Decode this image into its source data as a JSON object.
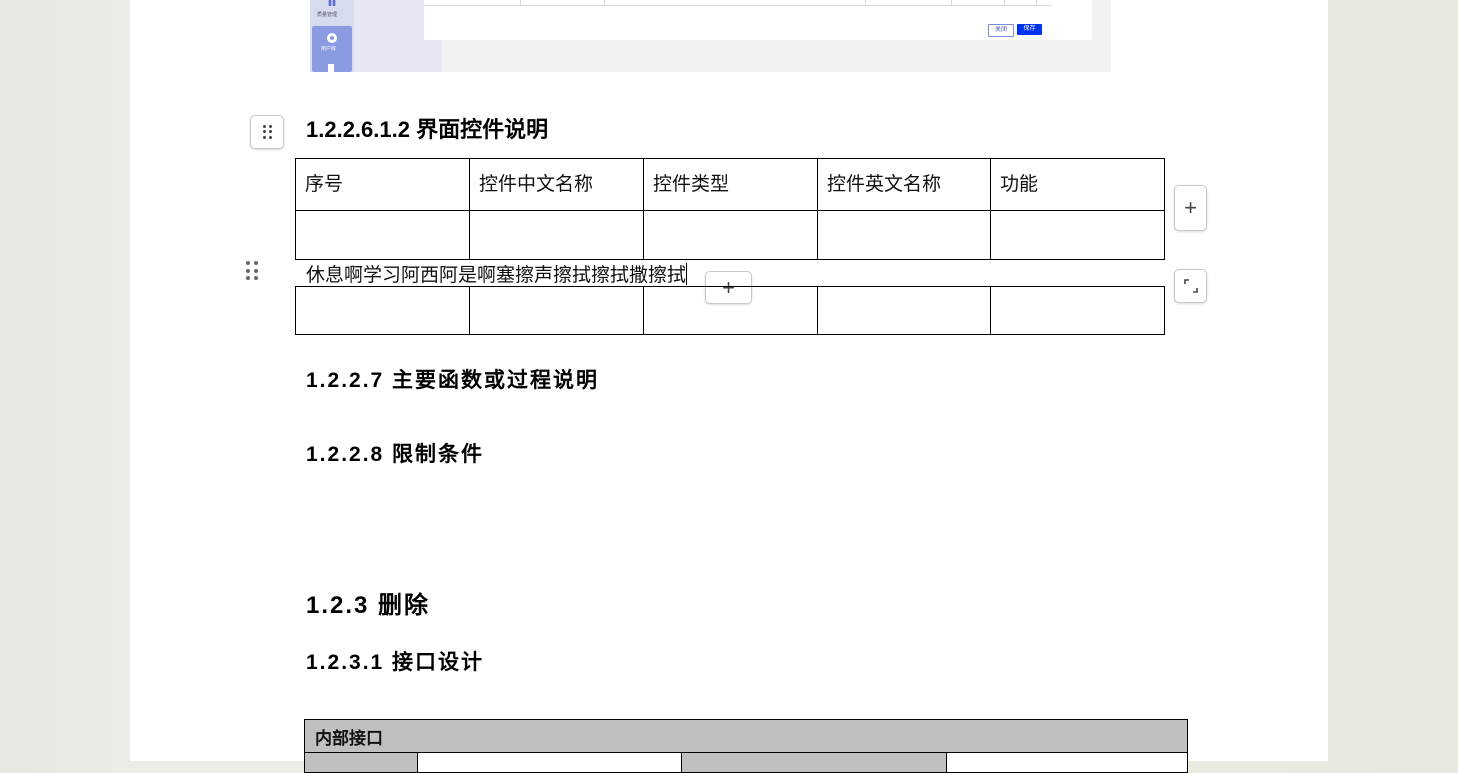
{
  "embedded_screenshot": {
    "nav_labels": [
      "质量管理",
      "用户库"
    ],
    "buttons": {
      "close": "关闭",
      "save": "保存"
    }
  },
  "section_ui_controls": {
    "title": "1.2.2.6.1.2 界面控件说明",
    "table_headers": [
      "序号",
      "控件中文名称",
      "控件类型",
      "控件英文名称",
      "功能"
    ]
  },
  "inserted_paragraph": "休息啊学习阿西阿是啊塞擦声擦拭擦拭撒擦拭",
  "headings": {
    "h_1227": "1.2.2.7 主要函数或过程说明",
    "h_1228": "1.2.2.8 限制条件",
    "h_123": "1.2.3 删除",
    "h_1231": "1.2.3.1 接口设计"
  },
  "interface_table": {
    "title": "内部接口"
  },
  "icons": {
    "drag_handle": "drag-handle-icon",
    "add": "plus-icon",
    "expand": "expand-corners-icon"
  }
}
